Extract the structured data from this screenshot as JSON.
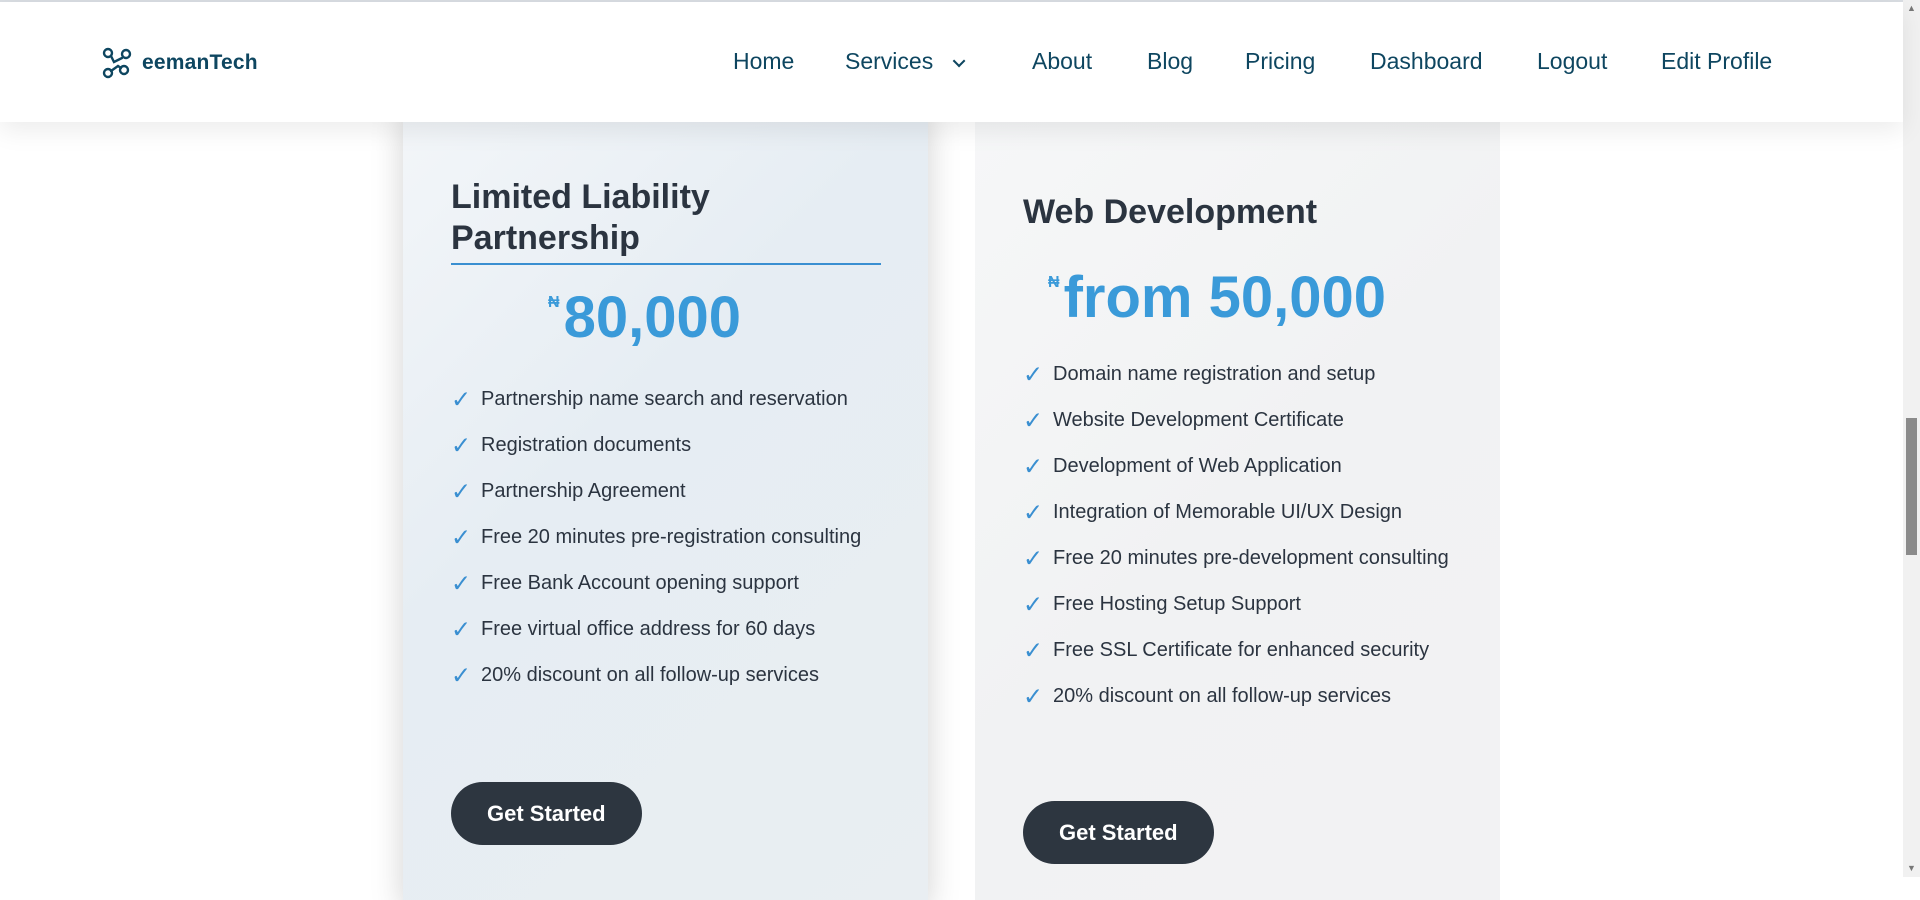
{
  "brand": {
    "name": "eemanTech",
    "logo_icon": "nodes-logo-icon",
    "color": "#0e4660"
  },
  "nav": {
    "items": [
      {
        "label": "Home"
      },
      {
        "label": "Services",
        "has_dropdown": true
      },
      {
        "label": "About"
      },
      {
        "label": "Blog"
      },
      {
        "label": "Pricing"
      },
      {
        "label": "Dashboard"
      },
      {
        "label": "Logout"
      },
      {
        "label": "Edit Profile"
      }
    ]
  },
  "accent_color": "#3a9ad9",
  "button_color": "#2d3640",
  "plans": [
    {
      "title": "Limited Liability Partnership",
      "currency": "₦",
      "price": "80,000",
      "features": [
        "Partnership name search and reservation",
        "Registration documents",
        "Partnership Agreement",
        "Free 20 minutes pre-registration consulting",
        "Free Bank Account opening support",
        "Free virtual office address for 60 days",
        "20% discount on all follow-up services"
      ],
      "cta": "Get Started"
    },
    {
      "title": "Web Development",
      "currency": "₦",
      "price": "from 50,000",
      "features": [
        "Domain name registration and setup",
        "Website Development Certificate",
        "Development of Web Application",
        "Integration of Memorable UI/UX Design",
        "Free 20 minutes pre-development consulting",
        "Free Hosting Setup Support",
        "Free SSL Certificate for enhanced security",
        "20% discount on all follow-up services"
      ],
      "cta": "Get Started"
    }
  ],
  "check_icon": "check-icon"
}
